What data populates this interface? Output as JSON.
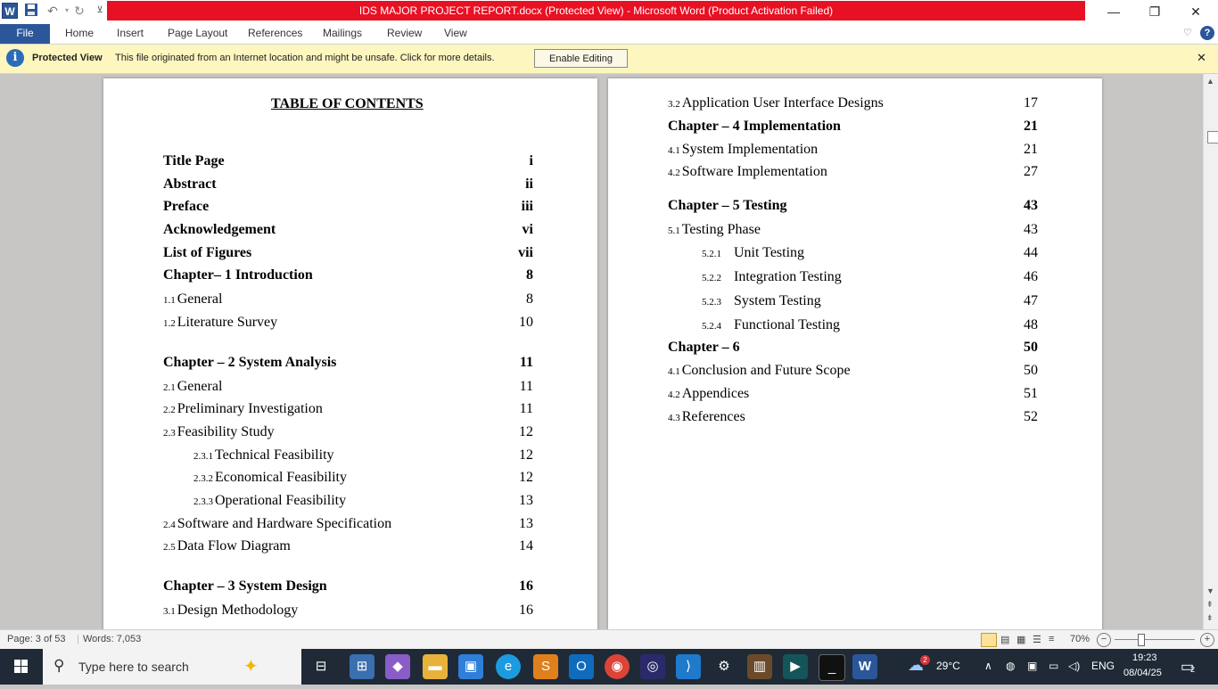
{
  "window": {
    "title": "IDS MAJOR PROJECT REPORT.docx (Protected View)  -  Microsoft Word (Product Activation Failed)",
    "app_letter": "W",
    "minimize": "—",
    "maximize": "❐",
    "close": "✕"
  },
  "ribbon": {
    "tabs": [
      "File",
      "Home",
      "Insert",
      "Page Layout",
      "References",
      "Mailings",
      "Review",
      "View"
    ]
  },
  "protected_view": {
    "title": "Protected View",
    "message": "This file originated from an Internet location and might be unsafe. Click for more details.",
    "button": "Enable Editing",
    "icon_glyph": "i"
  },
  "toc": {
    "heading": "TABLE OF CONTENTS",
    "left": [
      {
        "num": "",
        "label": "Title Page",
        "page": "i",
        "bold": true
      },
      {
        "num": "",
        "label": "Abstract",
        "page": "ii",
        "bold": true
      },
      {
        "num": "",
        "label": "Preface",
        "page": "iii",
        "bold": true
      },
      {
        "num": "",
        "label": "Acknowledgement",
        "page": "vi",
        "bold": true
      },
      {
        "num": "",
        "label": "List of Figures",
        "page": "vii",
        "bold": true
      },
      {
        "num": "",
        "label": "Chapter– 1 Introduction",
        "page": "8",
        "bold": true
      },
      {
        "num": "1.1",
        "label": "General",
        "page": "8",
        "bold": false
      },
      {
        "num": "1.2",
        "label": "Literature Survey",
        "page": "10",
        "bold": false
      },
      {
        "num": "",
        "label": "Chapter – 2 System Analysis",
        "page": "11",
        "bold": true
      },
      {
        "num": "2.1",
        "label": "General",
        "page": "11",
        "bold": false
      },
      {
        "num": "2.2",
        "label": "Preliminary Investigation",
        "page": "11",
        "bold": false
      },
      {
        "num": "2.3",
        "label": "Feasibility Study",
        "page": "12",
        "bold": false
      },
      {
        "num": "2.3.1",
        "label": "Technical Feasibility",
        "page": "12",
        "bold": false
      },
      {
        "num": "2.3.2",
        "label": "Economical Feasibility",
        "page": "12",
        "bold": false
      },
      {
        "num": "2.3.3",
        "label": "Operational Feasibility",
        "page": "13",
        "bold": false
      },
      {
        "num": "2.4",
        "label": "Software and Hardware Specification",
        "page": "13",
        "bold": false
      },
      {
        "num": "2.5",
        "label": "Data Flow Diagram",
        "page": "14",
        "bold": false
      },
      {
        "num": "",
        "label": "Chapter – 3 System Design",
        "page": "16",
        "bold": true
      },
      {
        "num": "3.1",
        "label": "Design Methodology",
        "page": "16",
        "bold": false
      }
    ],
    "right": [
      {
        "num": "3.2",
        "label": "Application User Interface Designs",
        "page": "17",
        "bold": false
      },
      {
        "num": "",
        "label": "Chapter – 4 Implementation",
        "page": "21",
        "bold": true
      },
      {
        "num": "4.1",
        "label": "System Implementation",
        "page": "21",
        "bold": false
      },
      {
        "num": "4.2",
        "label": "Software Implementation",
        "page": "27",
        "bold": false
      },
      {
        "num": "",
        "label": "Chapter – 5 Testing",
        "page": "43",
        "bold": true
      },
      {
        "num": "5.1",
        "label": "Testing Phase",
        "page": "43",
        "bold": false
      },
      {
        "num": "5.2.1",
        "label": "Unit Testing",
        "page": "44",
        "bold": false
      },
      {
        "num": "5.2.2",
        "label": "Integration Testing",
        "page": "46",
        "bold": false
      },
      {
        "num": "5.2.3",
        "label": "System Testing",
        "page": "47",
        "bold": false
      },
      {
        "num": "5.2.4",
        "label": "Functional Testing",
        "page": "48",
        "bold": false
      },
      {
        "num": "",
        "label": "Chapter – 6",
        "page": "50",
        "bold": true
      },
      {
        "num": "4.1",
        "label": "Conclusion and Future Scope",
        "page": "50",
        "bold": false
      },
      {
        "num": "4.2",
        "label": "Appendices",
        "page": "51",
        "bold": false
      },
      {
        "num": "4.3",
        "label": "References",
        "page": "52",
        "bold": false
      }
    ]
  },
  "status": {
    "page": "Page: 3 of 53",
    "words": "Words: 7,053",
    "zoom": "70%",
    "zoom_minus": "−",
    "zoom_plus": "+"
  },
  "taskbar": {
    "search_placeholder": "Type here to search",
    "weather": "29°C",
    "weather_badge": "2",
    "language": "ENG",
    "time": "19:23",
    "date": "08/04/25",
    "notif_count": "2"
  },
  "colors": {
    "title_red": "#e81123",
    "word_blue": "#2b579a",
    "protected_bar": "#fdf6bf",
    "taskbar": "#1f2a36"
  }
}
